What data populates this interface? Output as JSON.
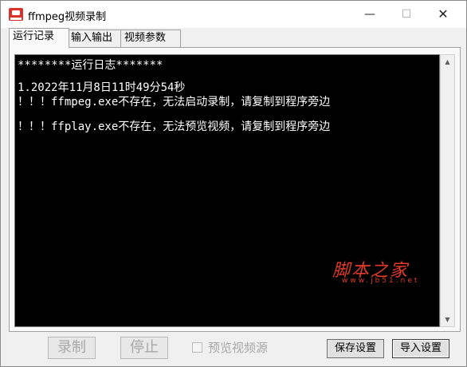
{
  "window": {
    "title": "ffmpeg视频录制"
  },
  "titlebar": {
    "minimize": "—",
    "maximize": "☐",
    "close": "✕"
  },
  "tabs": [
    {
      "label": "运行记录",
      "active": true
    },
    {
      "label": "输入输出",
      "active": false
    },
    {
      "label": "视频参数",
      "active": false
    }
  ],
  "log": {
    "lines": [
      "********运行日志*******",
      "",
      "1.2022年11月8日11时49分54秒",
      "！！！ffmpeg.exe不存在，无法启动录制，请复制到程序旁边",
      "",
      "！！！ffplay.exe不存在，无法预览视频，请复制到程序旁边"
    ]
  },
  "scrollbar": {
    "up": "▲",
    "down": "▼"
  },
  "watermark": {
    "text": "脚本之家",
    "url": "www.jb51.net"
  },
  "buttons": {
    "record": "录制",
    "stop": "停止",
    "preview_label": "预览视频源",
    "preview_checked": false,
    "save_settings": "保存设置",
    "import_settings": "导入设置"
  },
  "colors": {
    "log_bg": "#000000",
    "log_text": "#ffffff",
    "watermark": "#e23a2a"
  }
}
